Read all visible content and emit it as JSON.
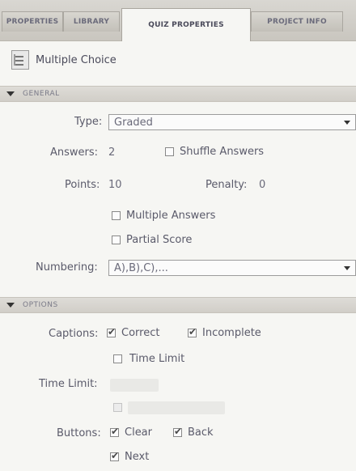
{
  "tabs": [
    "PROPERTIES",
    "LIBRARY",
    "QUIZ PROPERTIES",
    "PROJECT INFO"
  ],
  "header": {
    "title": "Multiple Choice",
    "icon": "list-icon"
  },
  "general": {
    "label": "GENERAL",
    "type_label": "Type:",
    "type_value": "Graded",
    "answers_label": "Answers:",
    "answers_value": "2",
    "shuffle_label": "Shuffle Answers",
    "points_label": "Points:",
    "points_value": "10",
    "penalty_label": "Penalty:",
    "penalty_value": "0",
    "multiple_answers_label": "Multiple Answers",
    "partial_score_label": "Partial Score",
    "numbering_label": "Numbering:",
    "numbering_value": "A),B),C),..."
  },
  "options": {
    "label": "OPTIONS",
    "captions_label": "Captions:",
    "correct_label": "Correct",
    "incomplete_label": "Incomplete",
    "time_limit_label": "Time Limit",
    "time_limit_field_label": "Time Limit:",
    "buttons_label": "Buttons:",
    "clear_label": "Clear",
    "back_label": "Back",
    "next_label": "Next"
  }
}
